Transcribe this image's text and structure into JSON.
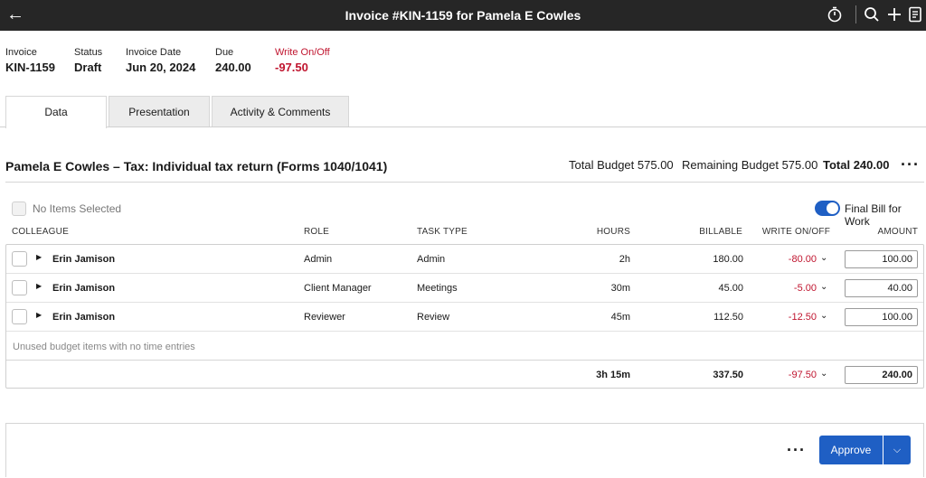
{
  "header": {
    "title": "Invoice #KIN-1159 for Pamela E Cowles"
  },
  "meta": {
    "invoice": {
      "label": "Invoice",
      "value": "KIN-1159"
    },
    "status": {
      "label": "Status",
      "value": "Draft"
    },
    "date": {
      "label": "Invoice Date",
      "value": "Jun 20, 2024"
    },
    "due": {
      "label": "Due",
      "value": "240.00"
    },
    "write": {
      "label": "Write On/Off",
      "value": "-97.50"
    }
  },
  "tabs": [
    {
      "label": "Data",
      "active": true
    },
    {
      "label": "Presentation",
      "active": false
    },
    {
      "label": "Activity & Comments",
      "active": false
    }
  ],
  "section": {
    "title": "Pamela E Cowles – Tax: Individual tax return (Forms 1040/1041)",
    "total_budget": "Total Budget 575.00",
    "remaining_budget": "Remaining Budget 575.00",
    "total": "Total 240.00"
  },
  "selection": {
    "text": "No Items Selected"
  },
  "final_bill": {
    "label": "Final Bill for Work",
    "on": true
  },
  "columns": [
    "COLLEAGUE",
    "ROLE",
    "TASK TYPE",
    "HOURS",
    "BILLABLE",
    "WRITE ON/OFF",
    "AMOUNT"
  ],
  "rows": [
    {
      "colleague": "Erin Jamison",
      "role": "Admin",
      "task": "Admin",
      "hours": "2h",
      "billable": "180.00",
      "write": "-80.00",
      "amount": "100.00"
    },
    {
      "colleague": "Erin Jamison",
      "role": "Client Manager",
      "task": "Meetings",
      "hours": "30m",
      "billable": "45.00",
      "write": "-5.00",
      "amount": "40.00"
    },
    {
      "colleague": "Erin Jamison",
      "role": "Reviewer",
      "task": "Review",
      "hours": "45m",
      "billable": "112.50",
      "write": "-12.50",
      "amount": "100.00"
    }
  ],
  "unused_text": "Unused budget items with no time entries",
  "totals": {
    "hours": "3h 15m",
    "billable": "337.50",
    "write": "-97.50",
    "amount": "240.00"
  },
  "footer": {
    "approve_label": "Approve"
  },
  "colors": {
    "topbar": "#262626",
    "accent": "#1f5fc4",
    "negative": "#c0152f"
  }
}
